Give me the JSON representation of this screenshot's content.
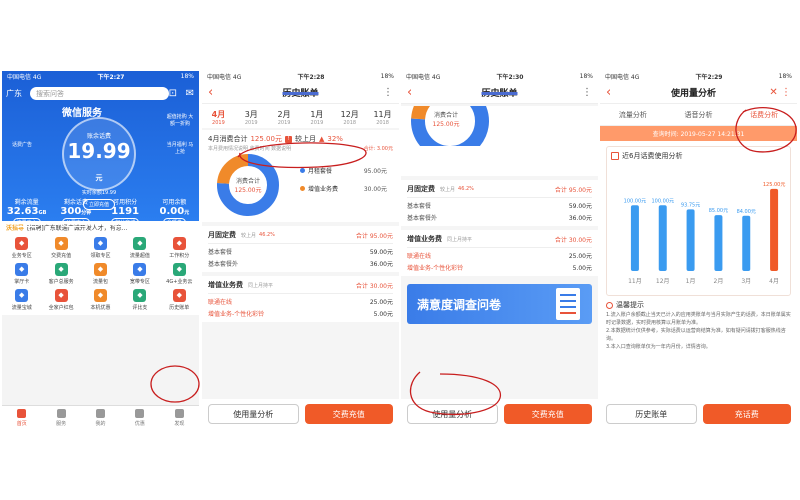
{
  "status": {
    "carrier": "中国电信 4G",
    "time1": "下午2:27",
    "time2": "下午2:28",
    "time3": "下午2:30",
    "time4": "下午2:29",
    "battery": "18%"
  },
  "p1": {
    "city": "广东",
    "search_placeholder": "搜索问答",
    "logo": "微信服务",
    "circle_label": "账余话费",
    "balance": "19.99",
    "unit": "元",
    "sub": "实时余额19.99",
    "btn": "立即充值",
    "side_left": "话费广告",
    "side_right_top": "超值抢购 大额一折购",
    "side_right_bottom": "当月福利 马上抢",
    "stats": [
      {
        "k": "剩余流量",
        "v": "32.63",
        "u": "GB",
        "b": "流量中心"
      },
      {
        "k": "剩余话费",
        "v": "300",
        "u": "分钟",
        "b": "公费中心"
      },
      {
        "k": "可用积分",
        "v": "1191",
        "u": "",
        "b": "积分商城"
      },
      {
        "k": "可用余额",
        "v": "0.00",
        "u": "元",
        "b": "余额券"
      }
    ],
    "ann_tag": "沃指导",
    "ann_text": "[招聘]广东联通广诚开发人才，有意...",
    "grid": [
      {
        "t": "业务专区",
        "c": "#e8533a"
      },
      {
        "t": "交费充值",
        "c": "#f08a2a"
      },
      {
        "t": "领取专区",
        "c": "#3a7ce8"
      },
      {
        "t": "流量超值",
        "c": "#2aa878"
      },
      {
        "t": "工作积分",
        "c": "#e8533a"
      },
      {
        "t": "掌厅卡",
        "c": "#3a7ce8"
      },
      {
        "t": "客户总服务",
        "c": "#2aa878"
      },
      {
        "t": "流量包",
        "c": "#f08a2a"
      },
      {
        "t": "宽带专区",
        "c": "#3a7ce8"
      },
      {
        "t": "4G+业务云",
        "c": "#2aa878"
      },
      {
        "t": "流量宝城",
        "c": "#3a7ce8"
      },
      {
        "t": "全家户红包",
        "c": "#e8533a"
      },
      {
        "t": "本机优惠",
        "c": "#f08a2a"
      },
      {
        "t": "评比支",
        "c": "#2aa878"
      },
      {
        "t": "历史账单",
        "c": "#e8533a"
      }
    ],
    "tabs": [
      "首页",
      "服务",
      "我的",
      "优惠",
      "发现"
    ]
  },
  "p2": {
    "title": "历史账单",
    "months": [
      {
        "m": "4月",
        "y": "2019"
      },
      {
        "m": "3月",
        "y": "2019"
      },
      {
        "m": "2月",
        "y": "2019"
      },
      {
        "m": "1月",
        "y": "2019"
      },
      {
        "m": "12月",
        "y": "2018"
      },
      {
        "m": "11月",
        "y": "2018"
      }
    ],
    "sum_label": "4月消费合计",
    "sum_amt": "125.00元",
    "sum_vs": "较上月",
    "sum_pct": "32%",
    "sub_left": "本月费用情况说明 收费时间 数据说明",
    "sub_right": "合计: 3.00元",
    "pie_center": "消费合计",
    "pie_amt": "125.00元",
    "legend": [
      {
        "n": "月租套餐",
        "v": "95.00元",
        "c": "#3a7ce8"
      },
      {
        "n": "增值业务费",
        "v": "30.00元",
        "c": "#f08a2a"
      }
    ],
    "sec1": {
      "title": "月固定费",
      "ch": "较上月",
      "pct": "46.2%",
      "tot": "合计 95.00元",
      "rows": [
        {
          "l": "基本套餐",
          "v": "59.00元"
        },
        {
          "l": "基本套餐外",
          "v": "36.00元"
        }
      ]
    },
    "sec2": {
      "title": "增值业务费",
      "ch": "同上月持平",
      "tot": "合计 30.00元",
      "rows": [
        {
          "l": "联通在线",
          "v": "25.00元"
        },
        {
          "l": "增值业务-个性化彩铃",
          "v": "5.00元"
        }
      ]
    },
    "btn_left": "使用量分析",
    "btn_right": "交费充值"
  },
  "p3": {
    "title": "历史账单",
    "pie_center": "消费合计",
    "pie_amt": "125.00元",
    "sec1": {
      "title": "月固定费",
      "ch": "较上月",
      "pct": "46.2%",
      "tot": "合计 95.00元",
      "rows": [
        {
          "l": "基本套餐",
          "v": "59.00元"
        },
        {
          "l": "基本套餐外",
          "v": "36.00元"
        }
      ]
    },
    "sec2": {
      "title": "增值业务费",
      "ch": "同上月持平",
      "tot": "合计 30.00元",
      "rows": [
        {
          "l": "联通在线",
          "v": "25.00元"
        },
        {
          "l": "增值业务-个性化彩铃",
          "v": "5.00元"
        }
      ]
    },
    "banner": "满意度调查问卷",
    "btn_left": "使用量分析",
    "btn_right": "交费充值"
  },
  "p4": {
    "title": "使用量分析",
    "tabs": [
      "流量分析",
      "语音分析",
      "话费分析"
    ],
    "qtime": "查询时间: 2019-05-27 14:21:31",
    "chart_title": "近6月话费使用分析",
    "tips_title": "温馨提示",
    "tips": [
      "1.流入账户余额截止当天已计入的应用类账单与当月实际产生的话费，本日账单属实时记录数据，实时费用核算以月账单为准。",
      "2.本数据统计仅供参考，实际话费以运营商结算为准，如有疑问请拨打客服热线咨询。",
      "3.本入口查询账单仅为一年内月份，详情咨询。"
    ],
    "btn_left": "历史账单",
    "btn_right": "充话费"
  },
  "chart_data": {
    "type": "bar",
    "title": "近6月话费使用分析",
    "categories": [
      "11月",
      "12月",
      "1月",
      "2月",
      "3月",
      "4月"
    ],
    "values": [
      100,
      100,
      93.75,
      85,
      84,
      125
    ],
    "labels": [
      "100.00元",
      "100.00元",
      "93.75元",
      "85.00元",
      "84.00元",
      "125.00元"
    ],
    "ylim": [
      0,
      140
    ],
    "colors": {
      "normal": "#3a9bf0",
      "highlight": "#f05a28"
    }
  },
  "pie_data": {
    "values": [
      95,
      30
    ],
    "colors": [
      "#3a7ce8",
      "#f08a2a"
    ]
  }
}
